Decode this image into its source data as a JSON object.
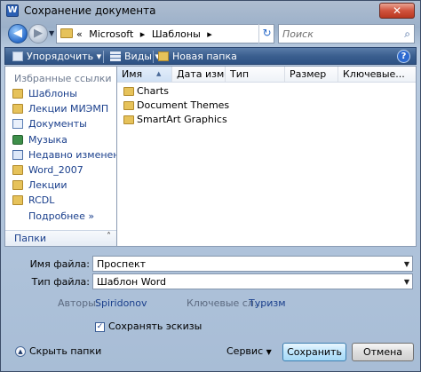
{
  "window": {
    "title": "Сохранение документа",
    "close_glyph": "✕"
  },
  "address": {
    "prefix": "«",
    "segments": [
      "Microsoft",
      "▸",
      "Шаблоны",
      "▸"
    ],
    "search_placeholder": "Поиск"
  },
  "toolbar": {
    "organize": "Упорядочить ▾",
    "views": "Виды ▾",
    "new_folder": "Новая папка",
    "help": "?"
  },
  "sidebar": {
    "header": "Избранные ссылки",
    "items": [
      {
        "label": "Шаблоны",
        "icon": "folder-icon"
      },
      {
        "label": "Лекции МИЭМП",
        "icon": "folder-icon"
      },
      {
        "label": "Документы",
        "icon": "documents-icon"
      },
      {
        "label": "Музыка",
        "icon": "music-icon"
      },
      {
        "label": "Недавно измененн...",
        "icon": "recent-icon"
      },
      {
        "label": "Word_2007",
        "icon": "folder-icon"
      },
      {
        "label": "Лекции",
        "icon": "folder-icon"
      },
      {
        "label": "RCDL",
        "icon": "folder-icon"
      }
    ],
    "more": "Подробнее",
    "more_glyph": "»",
    "folders": "Папки",
    "folders_glyph": "˄"
  },
  "columns": [
    "Имя",
    "Дата изме...",
    "Тип",
    "Размер",
    "Ключевые..."
  ],
  "files": [
    {
      "name": "Charts",
      "icon": "folder-icon"
    },
    {
      "name": "Document Themes",
      "icon": "folder-icon"
    },
    {
      "name": "SmartArt Graphics",
      "icon": "folder-icon"
    }
  ],
  "form": {
    "filename_label": "Имя файла:",
    "filename_value": "Проспект",
    "filetype_label": "Тип файла:",
    "filetype_value": "Шаблон Word",
    "authors_label": "Авторы:",
    "authors_value": "Spiridonov",
    "keywords_label": "Ключевые сл...",
    "keywords_value": "Туризм",
    "thumbnail_label": "Сохранять эскизы",
    "thumbnail_checked": true
  },
  "footer": {
    "hide_folders": "Скрыть папки",
    "service": "Сервис",
    "save": "Сохранить",
    "cancel": "Отмена"
  }
}
